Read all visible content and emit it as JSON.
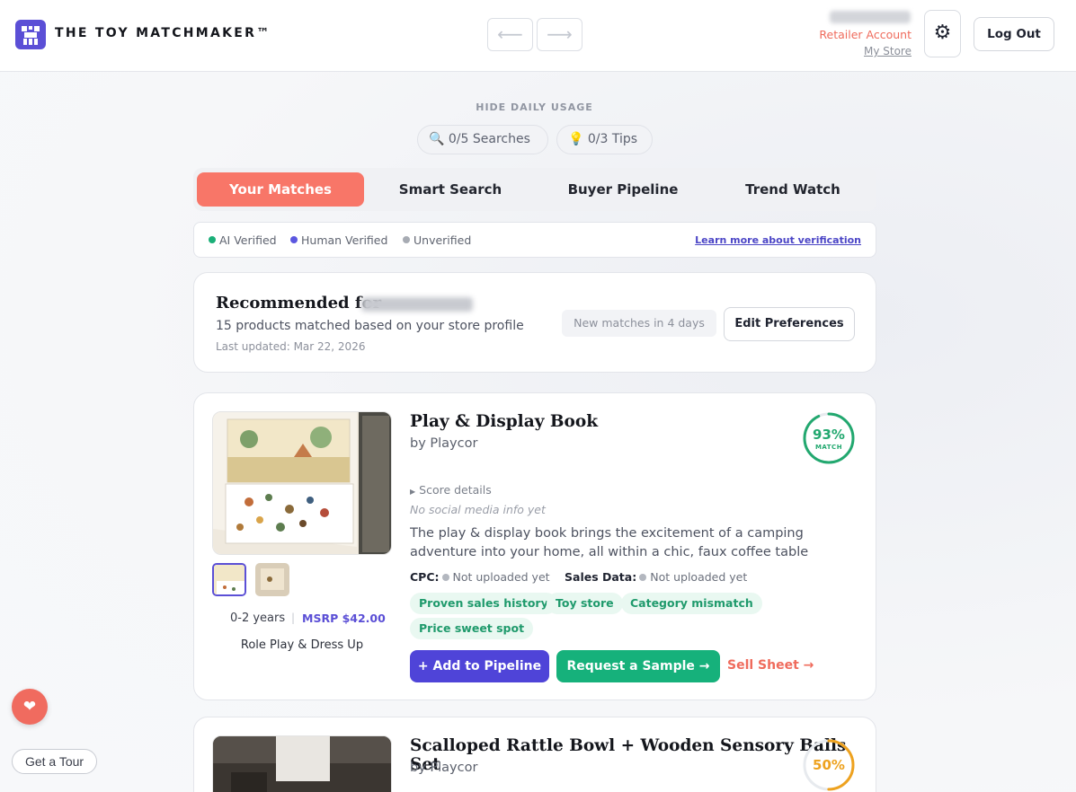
{
  "header": {
    "brand": "THE TOY MATCHMAKER™",
    "back_arrow": "⟵",
    "forward_arrow": "⟶",
    "account_type": "Retailer Account",
    "store_link": "My Store",
    "settings_icon": "⚙",
    "logout_label": "Log Out"
  },
  "usage": {
    "hide_label": "HIDE DAILY USAGE",
    "searches": "0/5 Searches",
    "tips": "0/3 Tips",
    "searches_icon": "🔍",
    "tips_icon": "💡"
  },
  "tabs": [
    {
      "label": "Your Matches",
      "active": true
    },
    {
      "label": "Smart Search",
      "active": false
    },
    {
      "label": "Buyer Pipeline",
      "active": false
    },
    {
      "label": "Trend Watch",
      "active": false
    }
  ],
  "legend": {
    "items": [
      {
        "label": "AI Verified",
        "color": "#1aaf78"
      },
      {
        "label": "Human Verified",
        "color": "#5b57e0"
      },
      {
        "label": "Unverified",
        "color": "#a7abb3"
      }
    ],
    "link": "Learn more about verification"
  },
  "recommendation": {
    "title": "Recommended for",
    "subtitle": "15 products matched based on your store profile",
    "updated": "Last updated: Mar 22, 2026",
    "badge": "New matches in 4 days",
    "edit_label": "Edit Preferences"
  },
  "products": [
    {
      "title": "Play & Display Book",
      "by": "by Playcor",
      "match": 93,
      "match_label": "93%",
      "match_sub": "MATCH",
      "score_details": "Score details",
      "social": "No social media info yet",
      "description": "The play & display book brings the excitement of a camping adventure into your home, all within a chic, faux coffee table design...",
      "cpc_label": "CPC:",
      "cpc_value": "Not uploaded yet",
      "sales_label": "Sales Data:",
      "sales_value": "Not uploaded yet",
      "tags": [
        "Proven sales history",
        "Toy store",
        "Category mismatch",
        "Price sweet spot"
      ],
      "age": "0-2 years",
      "msrp": "MSRP $42.00",
      "category": "Role Play & Dress Up",
      "add_pipeline": "+ Add to Pipeline",
      "request_sample": "Request a Sample →",
      "sell_sheet": "Sell Sheet →"
    },
    {
      "title": "Scalloped Rattle Bowl + Wooden Sensory Balls Set",
      "by": "by Playcor",
      "match": 50,
      "match_label": "50%"
    }
  ],
  "floating": {
    "heart_icon": "❤",
    "tour_label": "Get a Tour"
  }
}
